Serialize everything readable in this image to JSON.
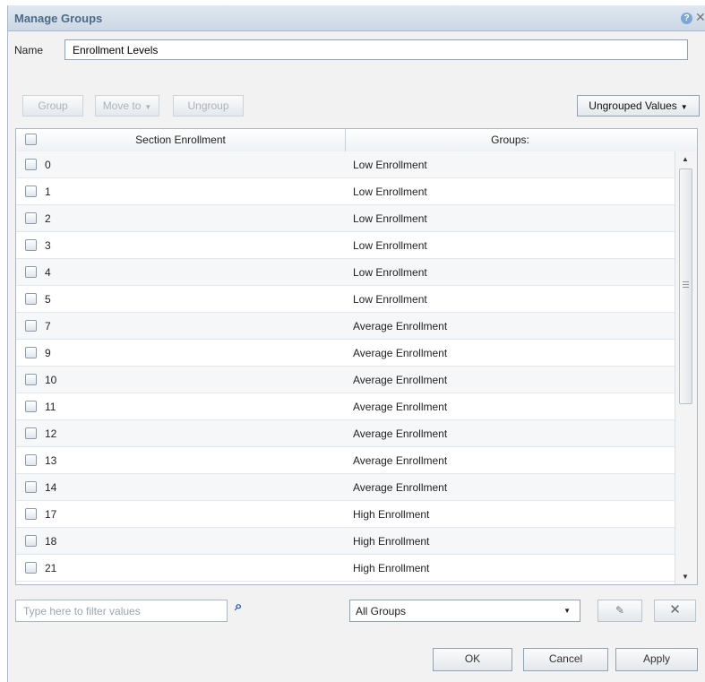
{
  "dialog": {
    "title": "Manage Groups"
  },
  "name": {
    "label": "Name",
    "value": "Enrollment Levels"
  },
  "toolbar": {
    "group": "Group",
    "move_to": "Move to",
    "ungroup": "Ungroup",
    "view_menu": "Ungrouped Values"
  },
  "grid": {
    "columns": [
      "Section Enrollment",
      "Groups:"
    ],
    "rows": [
      {
        "value": "0",
        "group": "Low Enrollment"
      },
      {
        "value": "1",
        "group": "Low Enrollment"
      },
      {
        "value": "2",
        "group": "Low Enrollment"
      },
      {
        "value": "3",
        "group": "Low Enrollment"
      },
      {
        "value": "4",
        "group": "Low Enrollment"
      },
      {
        "value": "5",
        "group": "Low Enrollment"
      },
      {
        "value": "7",
        "group": "Average Enrollment"
      },
      {
        "value": "9",
        "group": "Average Enrollment"
      },
      {
        "value": "10",
        "group": "Average Enrollment"
      },
      {
        "value": "11",
        "group": "Average Enrollment"
      },
      {
        "value": "12",
        "group": "Average Enrollment"
      },
      {
        "value": "13",
        "group": "Average Enrollment"
      },
      {
        "value": "14",
        "group": "Average Enrollment"
      },
      {
        "value": "17",
        "group": "High Enrollment"
      },
      {
        "value": "18",
        "group": "High Enrollment"
      },
      {
        "value": "21",
        "group": "High Enrollment"
      }
    ]
  },
  "filter": {
    "placeholder": "Type here to filter values"
  },
  "groups_select": {
    "value": "All Groups"
  },
  "footer": {
    "ok": "OK",
    "cancel": "Cancel",
    "apply": "Apply"
  },
  "icons": {
    "help": "help-icon",
    "close": "close-icon",
    "binoculars": "binoculars-icon",
    "edit": "pencil-icon",
    "delete": "x-icon"
  },
  "colors": {
    "title_text": "#4d6a87",
    "title_bar": "#cbd7e4",
    "border": "#a9b7c6"
  }
}
